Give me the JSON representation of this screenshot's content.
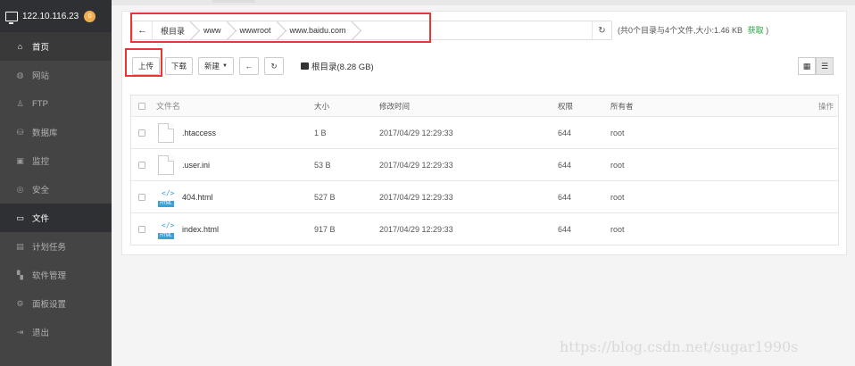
{
  "sidebar": {
    "server_ip": "122.10.116.23",
    "badge": "0",
    "items": [
      {
        "label": "首页",
        "icon": "home-icon"
      },
      {
        "label": "网站",
        "icon": "globe-icon"
      },
      {
        "label": "FTP",
        "icon": "ftp-icon"
      },
      {
        "label": "数据库",
        "icon": "database-icon"
      },
      {
        "label": "监控",
        "icon": "monitor-icon"
      },
      {
        "label": "安全",
        "icon": "shield-icon"
      },
      {
        "label": "文件",
        "icon": "folder-icon"
      },
      {
        "label": "计划任务",
        "icon": "calendar-icon"
      },
      {
        "label": "软件管理",
        "icon": "apps-icon"
      },
      {
        "label": "面板设置",
        "icon": "gear-icon"
      },
      {
        "label": "退出",
        "icon": "logout-icon"
      }
    ],
    "active": "文件"
  },
  "path": {
    "crumbs": [
      "根目录",
      "www",
      "wwwroot",
      "www.baidu.com"
    ]
  },
  "summary": {
    "text": "(共0个目录与4个文件,大小:1.46 KB",
    "link": "获取",
    "close": ")"
  },
  "toolbar": {
    "upload": "上传",
    "download": "下载",
    "new": "新建",
    "disk": "根目录(8.28 GB)"
  },
  "table": {
    "headers": {
      "name": "文件名",
      "size": "大小",
      "time": "修改时间",
      "perm": "权限",
      "owner": "所有者",
      "op": "操作"
    },
    "rows": [
      {
        "name": ".htaccess",
        "size": "1 B",
        "time": "2017/04/29 12:29:33",
        "perm": "644",
        "owner": "root"
      },
      {
        "name": ".user.ini",
        "size": "53 B",
        "time": "2017/04/29 12:29:33",
        "perm": "644",
        "owner": "root"
      },
      {
        "name": "404.html",
        "size": "527 B",
        "time": "2017/04/29 12:29:33",
        "perm": "644",
        "owner": "root"
      },
      {
        "name": "index.html",
        "size": "917 B",
        "time": "2017/04/29 12:29:33",
        "perm": "644",
        "owner": "root"
      }
    ]
  },
  "watermark": "https://blog.csdn.net/sugar1990s",
  "colors": {
    "sidebar": "#444444",
    "accent_green": "#20a53a",
    "badge": "#f0ad4e",
    "highlight_red": "#ee3333"
  }
}
